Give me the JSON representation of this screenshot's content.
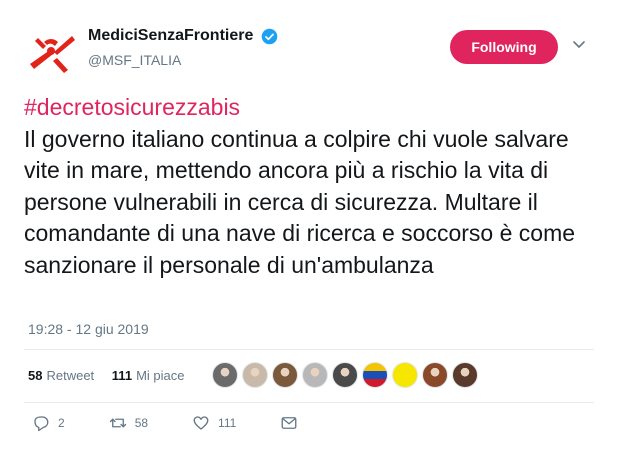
{
  "account": {
    "display_name": "MediciSenzaFrontiere",
    "handle": "@MSF_ITALIA",
    "brand_color": "#e0245e",
    "verified": true
  },
  "follow_button": {
    "label": "Following"
  },
  "tweet": {
    "hashtag": "#decretosicurezzabis",
    "body": "Il governo italiano continua a colpire chi vuole salvare vite in mare, mettendo ancora più a rischio la vita di persone vulnerabili in cerca di sicurezza. Multare il comandante di una nave di ricerca e soccorso è come sanzionare il personale di un'ambulanza",
    "timestamp": "19:28 - 12 giu 2019"
  },
  "stats": {
    "retweets_count": "58",
    "retweets_label": "Retweet",
    "likes_count": "111",
    "likes_label": "Mi piace"
  },
  "likers": [
    {
      "icon": "avatar-icon",
      "color": "#6b6b6b"
    },
    {
      "icon": "avatar-icon",
      "color": "#c9b9a8"
    },
    {
      "icon": "avatar-icon",
      "color": "#7a5a3a"
    },
    {
      "icon": "avatar-icon",
      "color": "#b8b8b8"
    },
    {
      "icon": "avatar-icon",
      "color": "#4a4a4a"
    },
    {
      "icon": "flag-icon",
      "color": "#f4c400"
    },
    {
      "icon": "yellow-poster-icon",
      "color": "#f7e600"
    },
    {
      "icon": "avatar-icon",
      "color": "#8a4a2a"
    },
    {
      "icon": "avatar-icon",
      "color": "#5a3a2a"
    }
  ],
  "actions": {
    "reply_count": "2",
    "retweet_count": "58",
    "like_count": "111"
  }
}
